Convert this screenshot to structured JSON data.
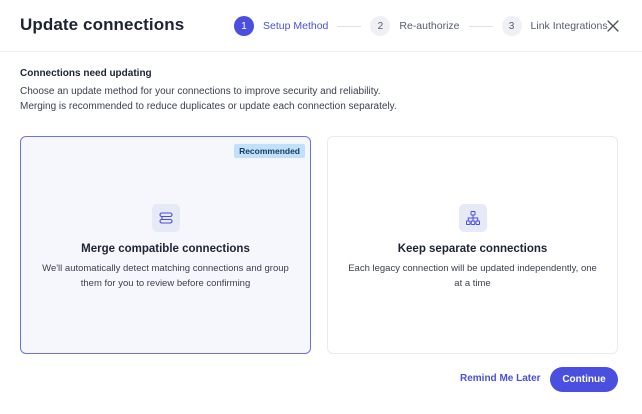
{
  "header": {
    "title": "Update connections",
    "steps": [
      {
        "number": "1",
        "label": "Setup Method"
      },
      {
        "number": "2",
        "label": "Re-authorize"
      },
      {
        "number": "3",
        "label": "Link Integrations"
      }
    ],
    "close_icon": "close-icon"
  },
  "intro": {
    "heading": "Connections need updating",
    "line1": "Choose an update method for your connections to improve security and reliability.",
    "line2": "Merging is recommended to reduce duplicates or update each connection separately."
  },
  "options": {
    "merge": {
      "badge": "Recommended",
      "icon": "merge-icon",
      "title": "Merge compatible connections",
      "description": "We'll automatically detect matching connections and group them for you to review before confirming"
    },
    "separate": {
      "icon": "hierarchy-icon",
      "title": "Keep separate connections",
      "description": "Each legacy connection will be updated independently, one at a time"
    }
  },
  "footer": {
    "remind_label": "Remind Me Later",
    "continue_label": "Continue"
  },
  "colors": {
    "accent": "#4a4fe0",
    "selected_border": "#6e72e8",
    "badge_bg": "#bfe1fb"
  }
}
